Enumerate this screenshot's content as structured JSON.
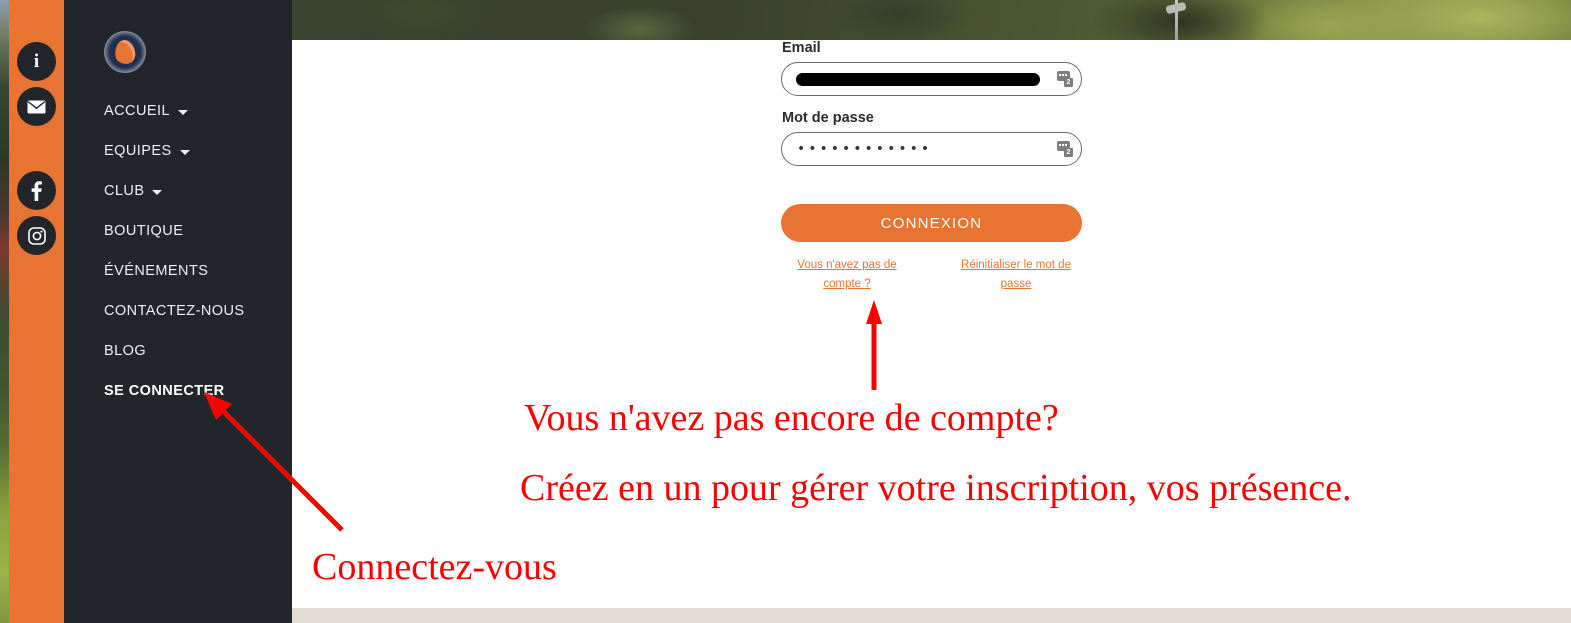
{
  "social_rail": {
    "items": [
      {
        "name": "info",
        "icon": "info-icon",
        "glyph": "i"
      },
      {
        "name": "email",
        "icon": "envelope-icon",
        "glyph": ""
      },
      {
        "name": "facebook",
        "icon": "facebook-icon",
        "glyph": "f"
      },
      {
        "name": "instagram",
        "icon": "instagram-icon",
        "glyph": ""
      }
    ]
  },
  "sidebar": {
    "logo_alt": "club-crest-logo",
    "items": [
      {
        "label": "ACCUEIL",
        "has_caret": true,
        "active": false
      },
      {
        "label": "EQUIPES",
        "has_caret": true,
        "active": false
      },
      {
        "label": "CLUB",
        "has_caret": true,
        "active": false
      },
      {
        "label": "BOUTIQUE",
        "has_caret": false,
        "active": false
      },
      {
        "label": "ÉVÉNEMENTS",
        "has_caret": false,
        "active": false
      },
      {
        "label": "CONTACTEZ-NOUS",
        "has_caret": false,
        "active": false
      },
      {
        "label": "BLOG",
        "has_caret": false,
        "active": false
      },
      {
        "label": "SE CONNECTER",
        "has_caret": false,
        "active": true
      }
    ]
  },
  "login_form": {
    "email": {
      "label": "Email",
      "value": "",
      "redacted": true,
      "password_manager_count": "2"
    },
    "password": {
      "label": "Mot de passe",
      "value": "••••••••••••",
      "password_manager_count": "2"
    },
    "submit_label": "CONNEXION",
    "links": [
      {
        "text": "Vous n'avez pas de compte ?"
      },
      {
        "text": "Réinitialiser le mot de passe"
      }
    ]
  },
  "annotations": {
    "question": "Vous n'avez pas encore de compte?",
    "create": "Créez en un pour gérer votre inscription, vos présence.",
    "connect": "Connectez-vous"
  },
  "colors": {
    "brand_orange": "#e87434",
    "sidebar_dark": "#22262b",
    "annotation_red": "#fb0000",
    "footer_beige": "#e3dcd2"
  }
}
